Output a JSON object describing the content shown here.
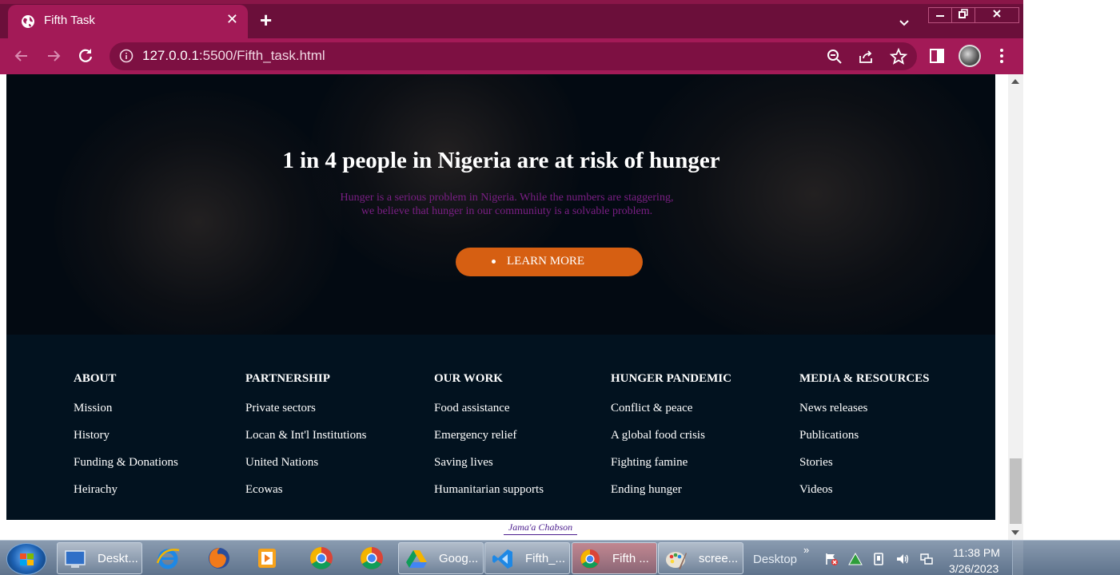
{
  "browser": {
    "tab_title": "Fifth Task",
    "url_host": "127.0.0.1",
    "url_rest": ":5500/Fifth_task.html",
    "colors": {
      "tab_strip": "#6b0f3a",
      "toolbar": "#a31a57",
      "omnibox": "#7d1042"
    }
  },
  "hero": {
    "title": "1 in 4 people in Nigeria are at risk of hunger",
    "text_line1": "Hunger is a serious problem in Nigeria. While the numbers are staggering,",
    "text_line2": "we believe that hunger in our communiuty is a solvable problem.",
    "button_label": "LEARN MORE",
    "colors": {
      "button": "#d65f12",
      "text": "#7a1f84",
      "background": "#030a12"
    }
  },
  "footer": {
    "columns": [
      {
        "heading": "ABOUT",
        "links": [
          "Mission",
          "History",
          "Funding & Donations",
          "Heirachy"
        ]
      },
      {
        "heading": "PARTNERSHIP",
        "links": [
          "Private sectors",
          "Locan & Int'l Institutions",
          "United Nations",
          "Ecowas"
        ]
      },
      {
        "heading": "OUR WORK",
        "links": [
          "Food assistance",
          "Emergency relief",
          "Saving lives",
          "Humanitarian supports"
        ]
      },
      {
        "heading": "HUNGER PANDEMIC",
        "links": [
          "Conflict & peace",
          "A global food crisis",
          "Fighting famine",
          "Ending hunger"
        ]
      },
      {
        "heading": "MEDIA & RESOURCES",
        "links": [
          "News releases",
          "Publications",
          "Stories",
          "Videos"
        ]
      }
    ],
    "credit": "Jama'a Chabson",
    "colors": {
      "background": "#02121f"
    }
  },
  "taskbar": {
    "tasks": [
      {
        "label": "Deskt...",
        "icon": "monitor-icon"
      },
      {
        "label": "Goog...",
        "icon": "google-drive-icon"
      },
      {
        "label": "Fifth_...",
        "icon": "vscode-icon"
      },
      {
        "label": "Fifth ...",
        "icon": "chrome-icon"
      },
      {
        "label": "scree...",
        "icon": "paint-icon"
      }
    ],
    "desktop_label": "Desktop",
    "chevron": "»",
    "time": "11:38 PM",
    "date": "3/26/2023"
  }
}
